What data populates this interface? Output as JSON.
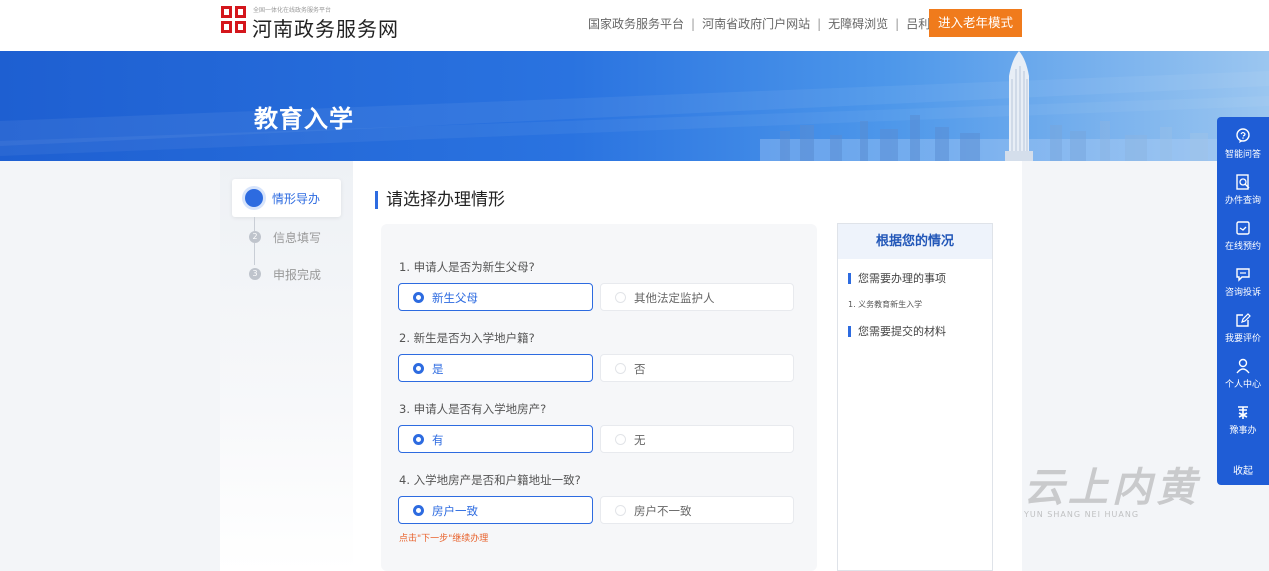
{
  "header": {
    "logo_small": "全国一体化在线政务服务平台",
    "logo_title": "河南政务服务网",
    "nav": [
      "国家政务服务平台",
      "河南省政府门户网站",
      "无障碍浏览",
      "吕利丹"
    ],
    "senior_mode": "进入老年模式"
  },
  "banner": {
    "title": "教育入学"
  },
  "steps": {
    "items": [
      {
        "label": "情形导办",
        "number": "1",
        "state": "active"
      },
      {
        "label": "信息填写",
        "number": "2",
        "state": "pending"
      },
      {
        "label": "申报完成",
        "number": "3",
        "state": "pending"
      }
    ]
  },
  "main": {
    "section_title": "请选择办理情形",
    "questions": [
      {
        "label": "1. 申请人是否为新生父母?",
        "selected": "新生父母",
        "other": "其他法定监护人"
      },
      {
        "label": "2. 新生是否为入学地户籍?",
        "selected": "是",
        "other": "否"
      },
      {
        "label": "3. 申请人是否有入学地房产?",
        "selected": "有",
        "other": "无"
      },
      {
        "label": "4. 入学地房产是否和户籍地址一致?",
        "selected": "房户一致",
        "other": "房户不一致"
      }
    ],
    "hint": "点击\"下一步\"继续办理"
  },
  "side_panel": {
    "title": "根据您的情况",
    "items_heading": "您需要办理的事项",
    "items": [
      "1. 义务教育新生入学"
    ],
    "materials_heading": "您需要提交的材料"
  },
  "sidebar": {
    "items": [
      {
        "label": "智能问答",
        "icon": "question-bubble-icon"
      },
      {
        "label": "办件查询",
        "icon": "search-doc-icon"
      },
      {
        "label": "在线预约",
        "icon": "calendar-icon"
      },
      {
        "label": "咨询投诉",
        "icon": "chat-icon"
      },
      {
        "label": "我要评价",
        "icon": "edit-icon"
      },
      {
        "label": "个人中心",
        "icon": "user-icon"
      },
      {
        "label": "豫事办",
        "icon": "yu-app-icon"
      }
    ],
    "collapse": "收起"
  },
  "watermark": {
    "text": "云上内黄",
    "sub": "YUN SHANG NEI HUANG"
  },
  "colors": {
    "primary": "#2d6be0",
    "accent_orange": "#f07b1c",
    "hint": "#e8622c",
    "sidebar": "#1f5dd6"
  }
}
